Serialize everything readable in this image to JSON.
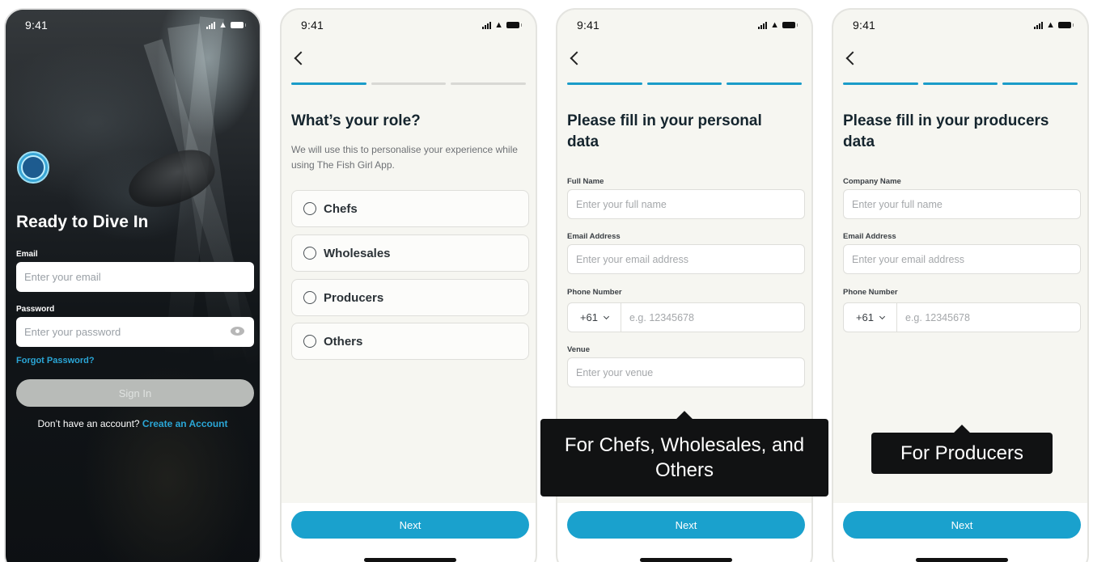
{
  "status": {
    "time": "9:41"
  },
  "login": {
    "title": "Ready to Dive In",
    "email_label": "Email",
    "email_placeholder": "Enter your email",
    "password_label": "Password",
    "password_placeholder": "Enter your password",
    "forgot": "Forgot Password?",
    "signin": "Sign In",
    "no_account": "Don’t have an account?",
    "create": "Create an Account"
  },
  "role": {
    "title": "What’s your role?",
    "subtitle": "We will use this to personalise your experience while using The Fish Girl App.",
    "options": [
      "Chefs",
      "Wholesales",
      "Producers",
      "Others"
    ],
    "next": "Next"
  },
  "personal": {
    "title": "Please fill in your personal data",
    "full_name_label": "Full Name",
    "full_name_placeholder": "Enter your full name",
    "email_label": "Email Address",
    "email_placeholder": "Enter your email address",
    "phone_label": "Phone Number",
    "country_code": "+61",
    "phone_placeholder": "e.g. 12345678",
    "venue_label": "Venue",
    "venue_placeholder": "Enter your venue",
    "next": "Next",
    "tooltip": "For Chefs, Wholesales, and Others"
  },
  "producers": {
    "title": "Please fill in your producers data",
    "company_label": "Company Name",
    "company_placeholder": "Enter your full name",
    "email_label": "Email Address",
    "email_placeholder": "Enter your email address",
    "phone_label": "Phone Number",
    "country_code": "+61",
    "phone_placeholder": "e.g. 12345678",
    "next": "Next",
    "tooltip": "For Producers"
  },
  "colors": {
    "accent": "#1aa1cd",
    "link": "#2aa6d6",
    "tooltip_bg": "#111213"
  }
}
